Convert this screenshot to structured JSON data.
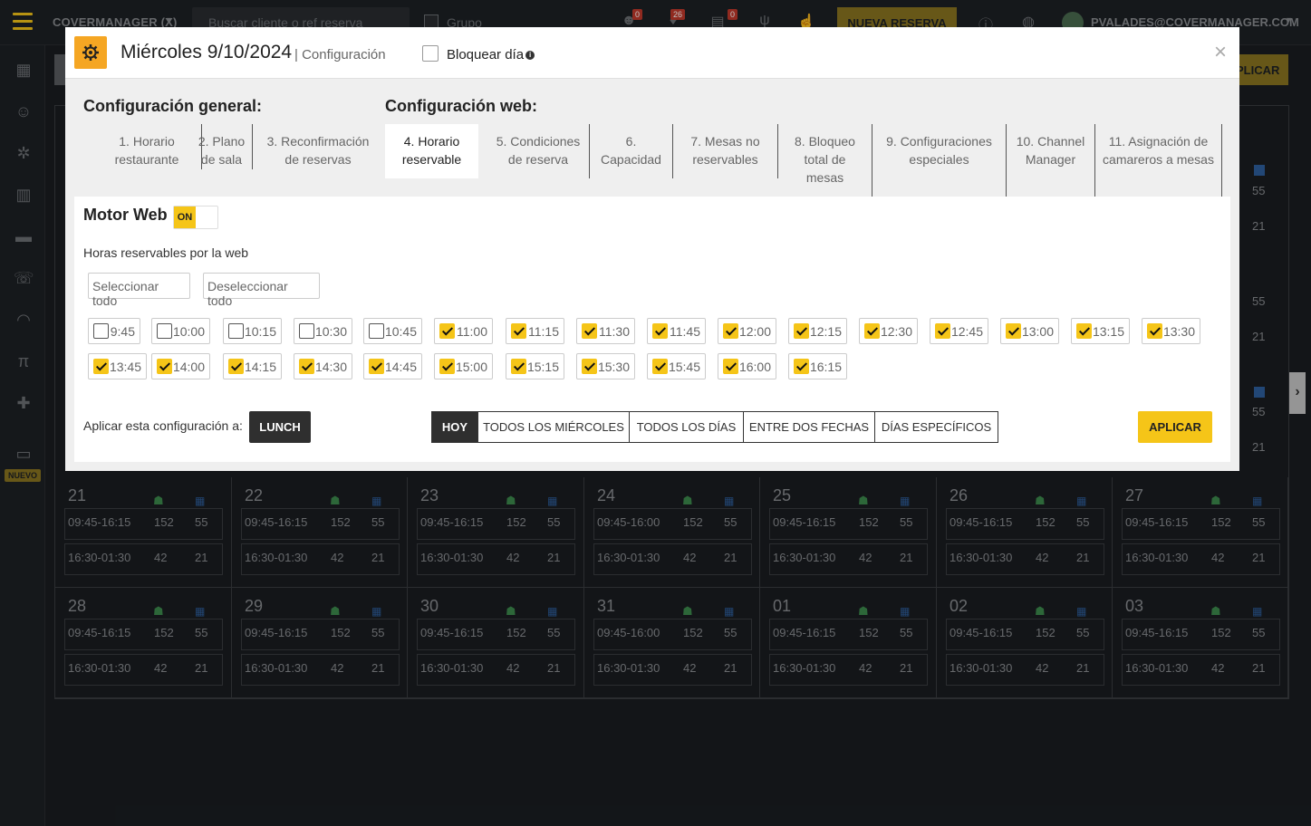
{
  "app": {
    "brand": "COVERMANAGER (X)",
    "search_placeholder": "Buscar cliente o ref reserva",
    "grupo_label": "Grupo",
    "badges": [
      "0",
      "26",
      "0"
    ],
    "new_reservation": "NUEVA RESERVA",
    "user": "PVALADES@COVERMANAGER.COM",
    "apply_partial": "PLICAR",
    "nuevo_badge": "NUEVO"
  },
  "calendar": {
    "rows": [
      {
        "days": [
          {
            "day": "21",
            "shifts": [
              {
                "hours": "09:45-16:15",
                "covers": "152",
                "tables": "55"
              },
              {
                "hours": "16:30-01:30",
                "covers": "42",
                "tables": "21"
              }
            ]
          },
          {
            "day": "22",
            "shifts": [
              {
                "hours": "09:45-16:15",
                "covers": "152",
                "tables": "55"
              },
              {
                "hours": "16:30-01:30",
                "covers": "42",
                "tables": "21"
              }
            ]
          },
          {
            "day": "23",
            "shifts": [
              {
                "hours": "09:45-16:15",
                "covers": "152",
                "tables": "55"
              },
              {
                "hours": "16:30-01:30",
                "covers": "42",
                "tables": "21"
              }
            ]
          },
          {
            "day": "24",
            "shifts": [
              {
                "hours": "09:45-16:00",
                "covers": "152",
                "tables": "55"
              },
              {
                "hours": "16:30-01:30",
                "covers": "42",
                "tables": "21"
              }
            ]
          },
          {
            "day": "25",
            "shifts": [
              {
                "hours": "09:45-16:15",
                "covers": "152",
                "tables": "55"
              },
              {
                "hours": "16:30-01:30",
                "covers": "42",
                "tables": "21"
              }
            ]
          },
          {
            "day": "26",
            "shifts": [
              {
                "hours": "09:45-16:15",
                "covers": "152",
                "tables": "55"
              },
              {
                "hours": "16:30-01:30",
                "covers": "42",
                "tables": "21"
              }
            ]
          },
          {
            "day": "27",
            "shifts": [
              {
                "hours": "09:45-16:15",
                "covers": "152",
                "tables": "55"
              },
              {
                "hours": "16:30-01:30",
                "covers": "42",
                "tables": "21"
              }
            ]
          }
        ]
      },
      {
        "days": [
          {
            "day": "28",
            "shifts": [
              {
                "hours": "09:45-16:15",
                "covers": "152",
                "tables": "55"
              },
              {
                "hours": "16:30-01:30",
                "covers": "42",
                "tables": "21"
              }
            ]
          },
          {
            "day": "29",
            "shifts": [
              {
                "hours": "09:45-16:15",
                "covers": "152",
                "tables": "55"
              },
              {
                "hours": "16:30-01:30",
                "covers": "42",
                "tables": "21"
              }
            ]
          },
          {
            "day": "30",
            "shifts": [
              {
                "hours": "09:45-16:15",
                "covers": "152",
                "tables": "55"
              },
              {
                "hours": "16:30-01:30",
                "covers": "42",
                "tables": "21"
              }
            ]
          },
          {
            "day": "31",
            "shifts": [
              {
                "hours": "09:45-16:00",
                "covers": "152",
                "tables": "55"
              },
              {
                "hours": "16:30-01:30",
                "covers": "42",
                "tables": "21"
              }
            ]
          },
          {
            "day": "01",
            "shifts": [
              {
                "hours": "09:45-16:15",
                "covers": "152",
                "tables": "55"
              },
              {
                "hours": "16:30-01:30",
                "covers": "42",
                "tables": "21"
              }
            ]
          },
          {
            "day": "02",
            "shifts": [
              {
                "hours": "09:45-16:15",
                "covers": "152",
                "tables": "55"
              },
              {
                "hours": "16:30-01:30",
                "covers": "42",
                "tables": "21"
              }
            ]
          },
          {
            "day": "03",
            "shifts": [
              {
                "hours": "09:45-16:15",
                "covers": "152",
                "tables": "55"
              },
              {
                "hours": "16:30-01:30",
                "covers": "42",
                "tables": "21"
              }
            ]
          }
        ]
      }
    ],
    "peek": [
      "55",
      "21",
      "55",
      "21",
      "55",
      "21"
    ]
  },
  "modal": {
    "title": "Miércoles 9/10/2024",
    "subtitle": "| Configuración",
    "block_day_label": "Bloquear día",
    "block_day_checked": false,
    "close": "×",
    "general_title": "Configuración general:",
    "web_title": "Configuración web:",
    "tabs": [
      {
        "label": "1. Horario restaurante"
      },
      {
        "label": "2. Plano de sala"
      },
      {
        "label": "3. Reconfirmación de reservas"
      },
      {
        "label": "4. Horario reservable"
      },
      {
        "label": "5. Condiciones de reserva"
      },
      {
        "label": "6. Capacidad"
      },
      {
        "label": "7. Mesas no reservables"
      },
      {
        "label": "8. Bloqueo total de mesas"
      },
      {
        "label": "9. Configuraciones especiales"
      },
      {
        "label": "10. Channel Manager"
      },
      {
        "label": "11. Asignación de camareros a mesas"
      }
    ],
    "active_tab": "4. Horario reservable",
    "motor_web_label": "Motor Web",
    "motor_web_toggle": "ON",
    "hours_label": "Horas reservables por la web",
    "select_all": "Seleccionar todo",
    "deselect_all": "Deseleccionar todo",
    "slots": [
      {
        "time": "9:45",
        "checked": false
      },
      {
        "time": "10:00",
        "checked": false
      },
      {
        "time": "10:15",
        "checked": false
      },
      {
        "time": "10:30",
        "checked": false
      },
      {
        "time": "10:45",
        "checked": false
      },
      {
        "time": "11:00",
        "checked": true
      },
      {
        "time": "11:15",
        "checked": true
      },
      {
        "time": "11:30",
        "checked": true
      },
      {
        "time": "11:45",
        "checked": true
      },
      {
        "time": "12:00",
        "checked": true
      },
      {
        "time": "12:15",
        "checked": true
      },
      {
        "time": "12:30",
        "checked": true
      },
      {
        "time": "12:45",
        "checked": true
      },
      {
        "time": "13:00",
        "checked": true
      },
      {
        "time": "13:15",
        "checked": true
      },
      {
        "time": "13:30",
        "checked": true
      },
      {
        "time": "13:45",
        "checked": true
      },
      {
        "time": "14:00",
        "checked": true
      },
      {
        "time": "14:15",
        "checked": true
      },
      {
        "time": "14:30",
        "checked": true
      },
      {
        "time": "14:45",
        "checked": true
      },
      {
        "time": "15:00",
        "checked": true
      },
      {
        "time": "15:15",
        "checked": true
      },
      {
        "time": "15:30",
        "checked": true
      },
      {
        "time": "15:45",
        "checked": true
      },
      {
        "time": "16:00",
        "checked": true
      },
      {
        "time": "16:15",
        "checked": true
      }
    ],
    "apply_to_label": "Aplicar esta configuración a:",
    "shift_button": "LUNCH",
    "scope_options": [
      "HOY",
      "TODOS LOS MIÉRCOLES",
      "TODOS LOS DÍAS",
      "ENTRE DOS FECHAS",
      "DÍAS ESPECÍFICOS"
    ],
    "scope_selected": "HOY",
    "apply_button": "APLICAR"
  },
  "colors": {
    "accent": "#f5c518",
    "dark_button": "#2f2f2f",
    "gear_badge": "#f5a623",
    "background": "#1a1d21"
  }
}
